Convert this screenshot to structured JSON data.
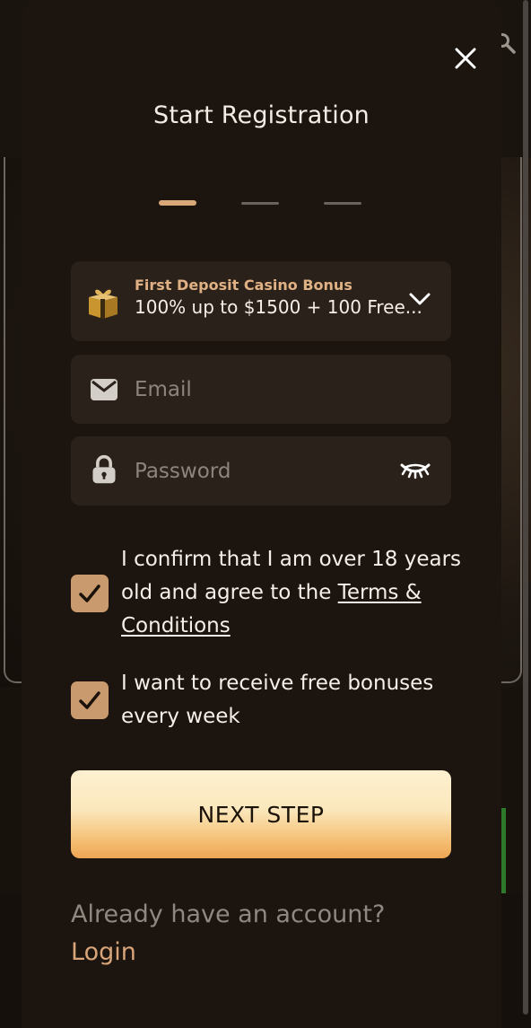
{
  "modal": {
    "title": "Start Registration",
    "steps": [
      {
        "state": "active"
      },
      {
        "state": "inactive"
      },
      {
        "state": "inactive"
      }
    ]
  },
  "bonus": {
    "title": "First Deposit Casino Bonus",
    "description": "100% up to $1500 + 100 Free...",
    "icon": "gift-box-icon"
  },
  "email": {
    "placeholder": "Email",
    "value": "",
    "icon": "envelope-icon"
  },
  "password": {
    "placeholder": "Password",
    "value": "",
    "icon": "lock-icon",
    "toggle_icon": "eye-closed-icon"
  },
  "checkboxes": {
    "age": {
      "checked": true,
      "text": "I confirm that I am over 18 years old and agree to the",
      "link": "Terms & Conditions"
    },
    "bonuses": {
      "checked": true,
      "text": "I want to receive free bonuses every week"
    }
  },
  "next_button": "NEXT STEP",
  "login_prompt": "Already have an account?",
  "login_link": "Login",
  "colors": {
    "modal_bg": "#1c150f",
    "field_bg": "#2a211a",
    "accent": "#d9a878",
    "checkbox": "#c89a6d",
    "button_top": "#fdf1d1",
    "button_bottom": "#eea553"
  }
}
